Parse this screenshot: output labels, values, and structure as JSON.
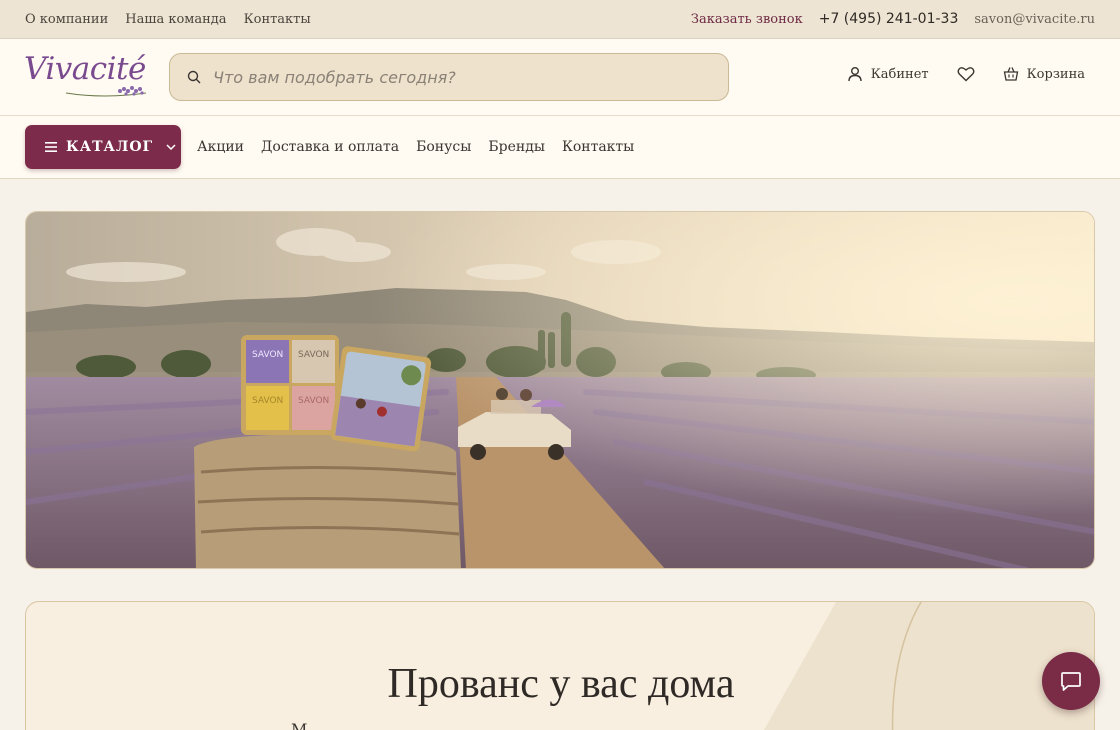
{
  "topbar": {
    "links": [
      "О компании",
      "Наша команда",
      "Контакты"
    ],
    "callback": "Заказать звонок",
    "phone": "+7 (495) 241-01-33",
    "email": "savon@vivacite.ru"
  },
  "header": {
    "logo_text": "Vivacité",
    "search_placeholder": "Что вам подобрать сегодня?",
    "account_label": "Кабинет",
    "cart_label": "Корзина"
  },
  "nav": {
    "catalog_label": "КАТАЛОГ",
    "links": [
      "Акции",
      "Доставка и оплата",
      "Бонусы",
      "Бренды",
      "Контакты"
    ]
  },
  "hero": {
    "soap_labels": [
      "SAVON",
      "SAVON",
      "SAVON",
      "SAVON"
    ]
  },
  "promo": {
    "title": "Прованс у вас дома",
    "subtitle": "М"
  },
  "colors": {
    "brand": "#7c2c4a",
    "logo": "#7a4a8f",
    "lavender": "#9c86b0"
  },
  "icons": [
    "search-icon",
    "user-icon",
    "heart-icon",
    "basket-icon",
    "menu-icon",
    "chevron-down-icon",
    "chat-icon"
  ]
}
